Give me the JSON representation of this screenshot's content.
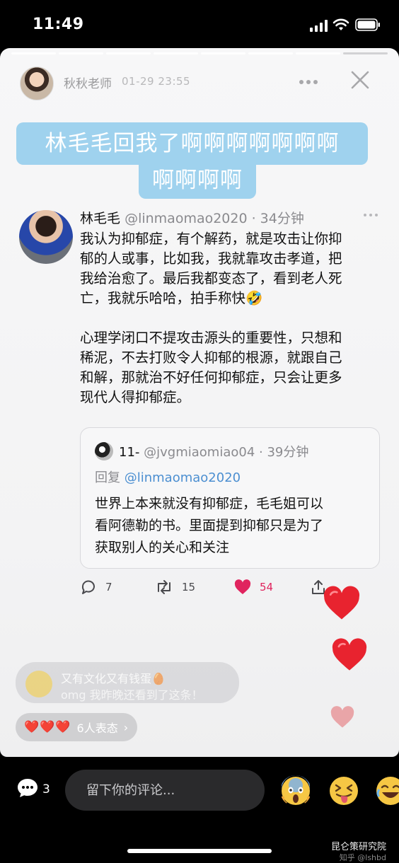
{
  "status_bar": {
    "time": "11:49"
  },
  "story": {
    "author": "秋秋老师",
    "posted_at": "01-29 23:55",
    "progress": {
      "segments": 8,
      "completed": 7
    },
    "sticker_line1": "林毛毛回我了啊啊啊啊啊啊啊",
    "sticker_line2": "啊啊啊啊"
  },
  "tweet": {
    "name": "林毛毛",
    "handle": "@linmaomao2020 · 34分钟",
    "paragraph1": "我认为抑郁症，有个解药，就是攻击让你抑\n郁的人或事，比如我，我就靠攻击孝道，把\n我给治愈了。最后我都变态了，看到老人死\n亡，我就乐哈哈，拍手称快🤣",
    "paragraph2": "心理学闭口不提攻击源头的重要性，只想和\n稀泥，不去打败令人抑郁的根源，就跟自己\n和解，那就治不好任何抑郁症，只会让更多\n现代人得抑郁症。",
    "quote": {
      "name": "11-",
      "handle": "@jvgmiaomiao04 · 39分钟",
      "reply_prefix": "回复 ",
      "reply_to": "@linmaomao2020",
      "body": "世界上本来就没有抑郁症，毛毛姐可以\n看阿德勒的书。里面提到抑郁只是为了\n获取别人的关心和关注"
    },
    "actions": {
      "replies": "7",
      "retweets": "15",
      "likes": "54"
    }
  },
  "comment_preview": {
    "line1": "又有文化又有钱蛋🥚",
    "line2": "omg 我昨晚还看到了这条！"
  },
  "reactions": {
    "hearts": "❤️❤️❤️",
    "label": "6人表态",
    "chevron": "›"
  },
  "bottom_bar": {
    "comment_count": "3",
    "input_placeholder": "留下你的评论...",
    "quick_emojis": [
      "😱",
      "😝",
      "😂"
    ]
  },
  "watermark": {
    "main": "昆仑策研究院",
    "sub": "知乎 @lshbd"
  },
  "colors": {
    "sticker_bg": "#9fd2ee",
    "like": "#e0245e",
    "mention": "#4c8fd1"
  }
}
